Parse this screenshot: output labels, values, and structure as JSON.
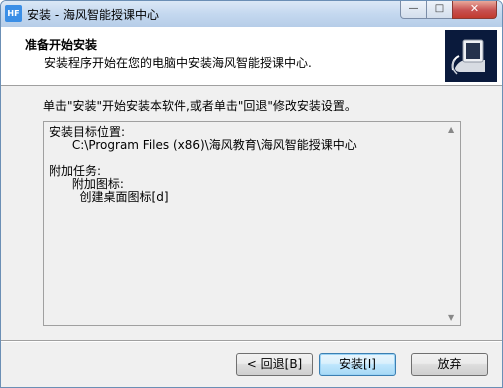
{
  "window": {
    "title": "安装 - 海风智能授课中心",
    "app_icon_text": "HF"
  },
  "titlebar_buttons": {
    "minimize": "—",
    "maximize": "□",
    "close": "✕"
  },
  "header": {
    "title": "准备开始安装",
    "subtitle": "安装程序开始在您的电脑中安装海风智能授课中心."
  },
  "instruction": "单击\"安装\"开始安装本软件,或者单击\"回退\"修改安装设置。",
  "summary_lines": [
    "安装目标位置:",
    "      C:\\Program Files (x86)\\海风教育\\海风智能授课中心",
    "",
    "附加任务:",
    "      附加图标:",
    "        创建桌面图标[d]"
  ],
  "buttons": {
    "back": "< 回退[B]",
    "install": "安装[I]",
    "cancel": "放弃"
  },
  "colors": {
    "logo_bg": "#0a1a3c",
    "default_button_border": "#3c7fb1"
  }
}
